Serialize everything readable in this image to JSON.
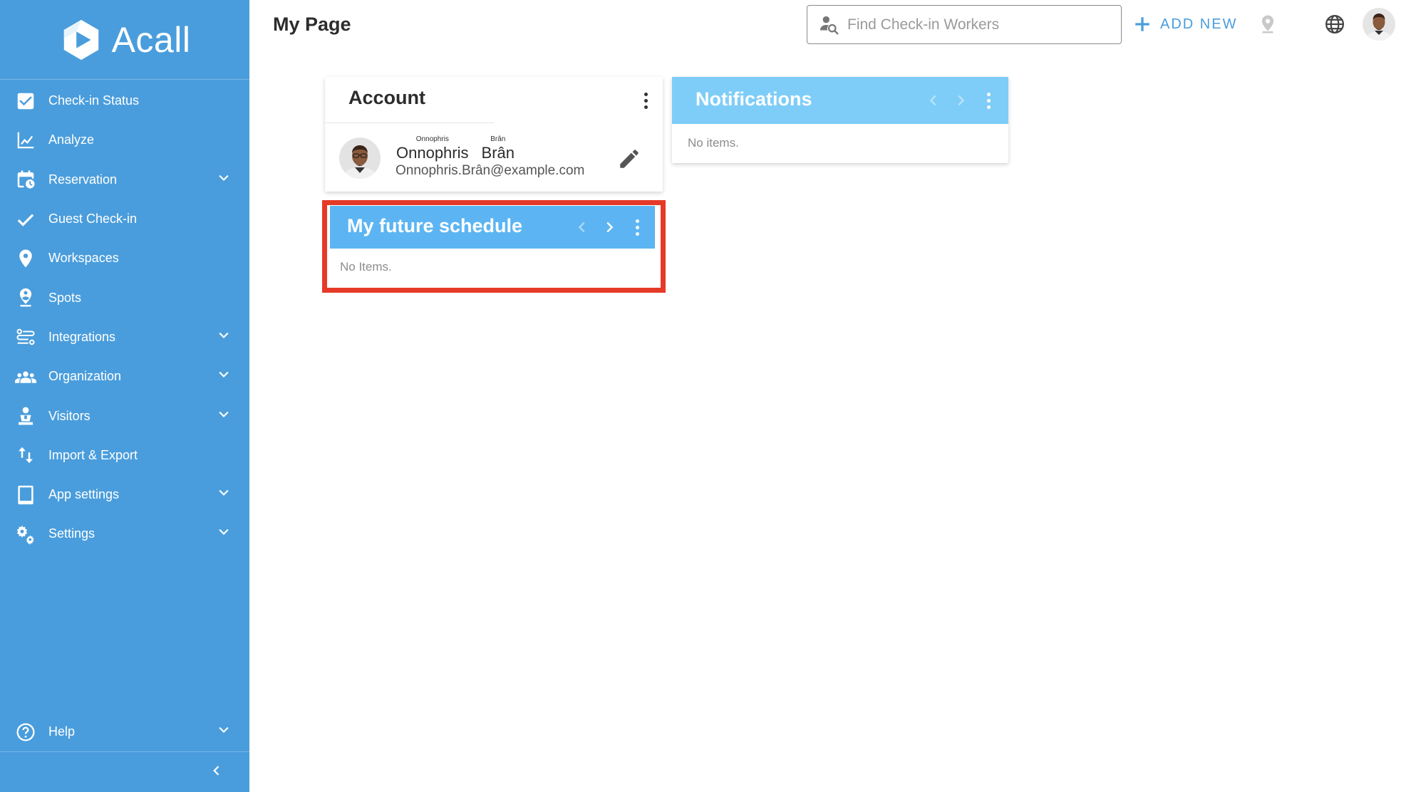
{
  "app": {
    "brand_name": "Acall",
    "page_title": "My Page"
  },
  "colors": {
    "sidebar": "#4a9ddc",
    "accent": "#4a9ddc",
    "card_header": "#7ecdf8",
    "schedule_header": "#5cb5f2",
    "highlight": "#e53a27"
  },
  "sidebar": {
    "items": [
      {
        "label": "Check-in Status",
        "icon": "checkbox-icon",
        "expandable": false
      },
      {
        "label": "Analyze",
        "icon": "line-chart-icon",
        "expandable": false
      },
      {
        "label": "Reservation",
        "icon": "calendar-clock-icon",
        "expandable": true
      },
      {
        "label": "Guest Check-in",
        "icon": "checkmark-icon",
        "expandable": false
      },
      {
        "label": "Workspaces",
        "icon": "map-pin-icon",
        "expandable": false
      },
      {
        "label": "Spots",
        "icon": "person-pin-icon",
        "expandable": false
      },
      {
        "label": "Integrations",
        "icon": "integrations-icon",
        "expandable": true
      },
      {
        "label": "Organization",
        "icon": "group-icon",
        "expandable": true
      },
      {
        "label": "Visitors",
        "icon": "visitor-icon",
        "expandable": true
      },
      {
        "label": "Import & Export",
        "icon": "import-export-icon",
        "expandable": false
      },
      {
        "label": "App settings",
        "icon": "tablet-icon",
        "expandable": true
      },
      {
        "label": "Settings",
        "icon": "gears-icon",
        "expandable": true
      }
    ],
    "help": {
      "label": "Help",
      "icon": "help-icon",
      "expandable": true
    }
  },
  "header": {
    "search": {
      "placeholder": "Find Check-in Workers",
      "value": ""
    },
    "add_new_label": "ADD NEW"
  },
  "account_card": {
    "title": "Account",
    "first_name": "Onnophris",
    "first_name_ruby": "Onnophris",
    "last_name": "Brân",
    "last_name_ruby": "Brân",
    "email": "Onnophris.Brân@example.com"
  },
  "notifications_card": {
    "title": "Notifications",
    "empty_text": "No items."
  },
  "schedule_card": {
    "title": "My future schedule",
    "empty_text": "No Items."
  }
}
